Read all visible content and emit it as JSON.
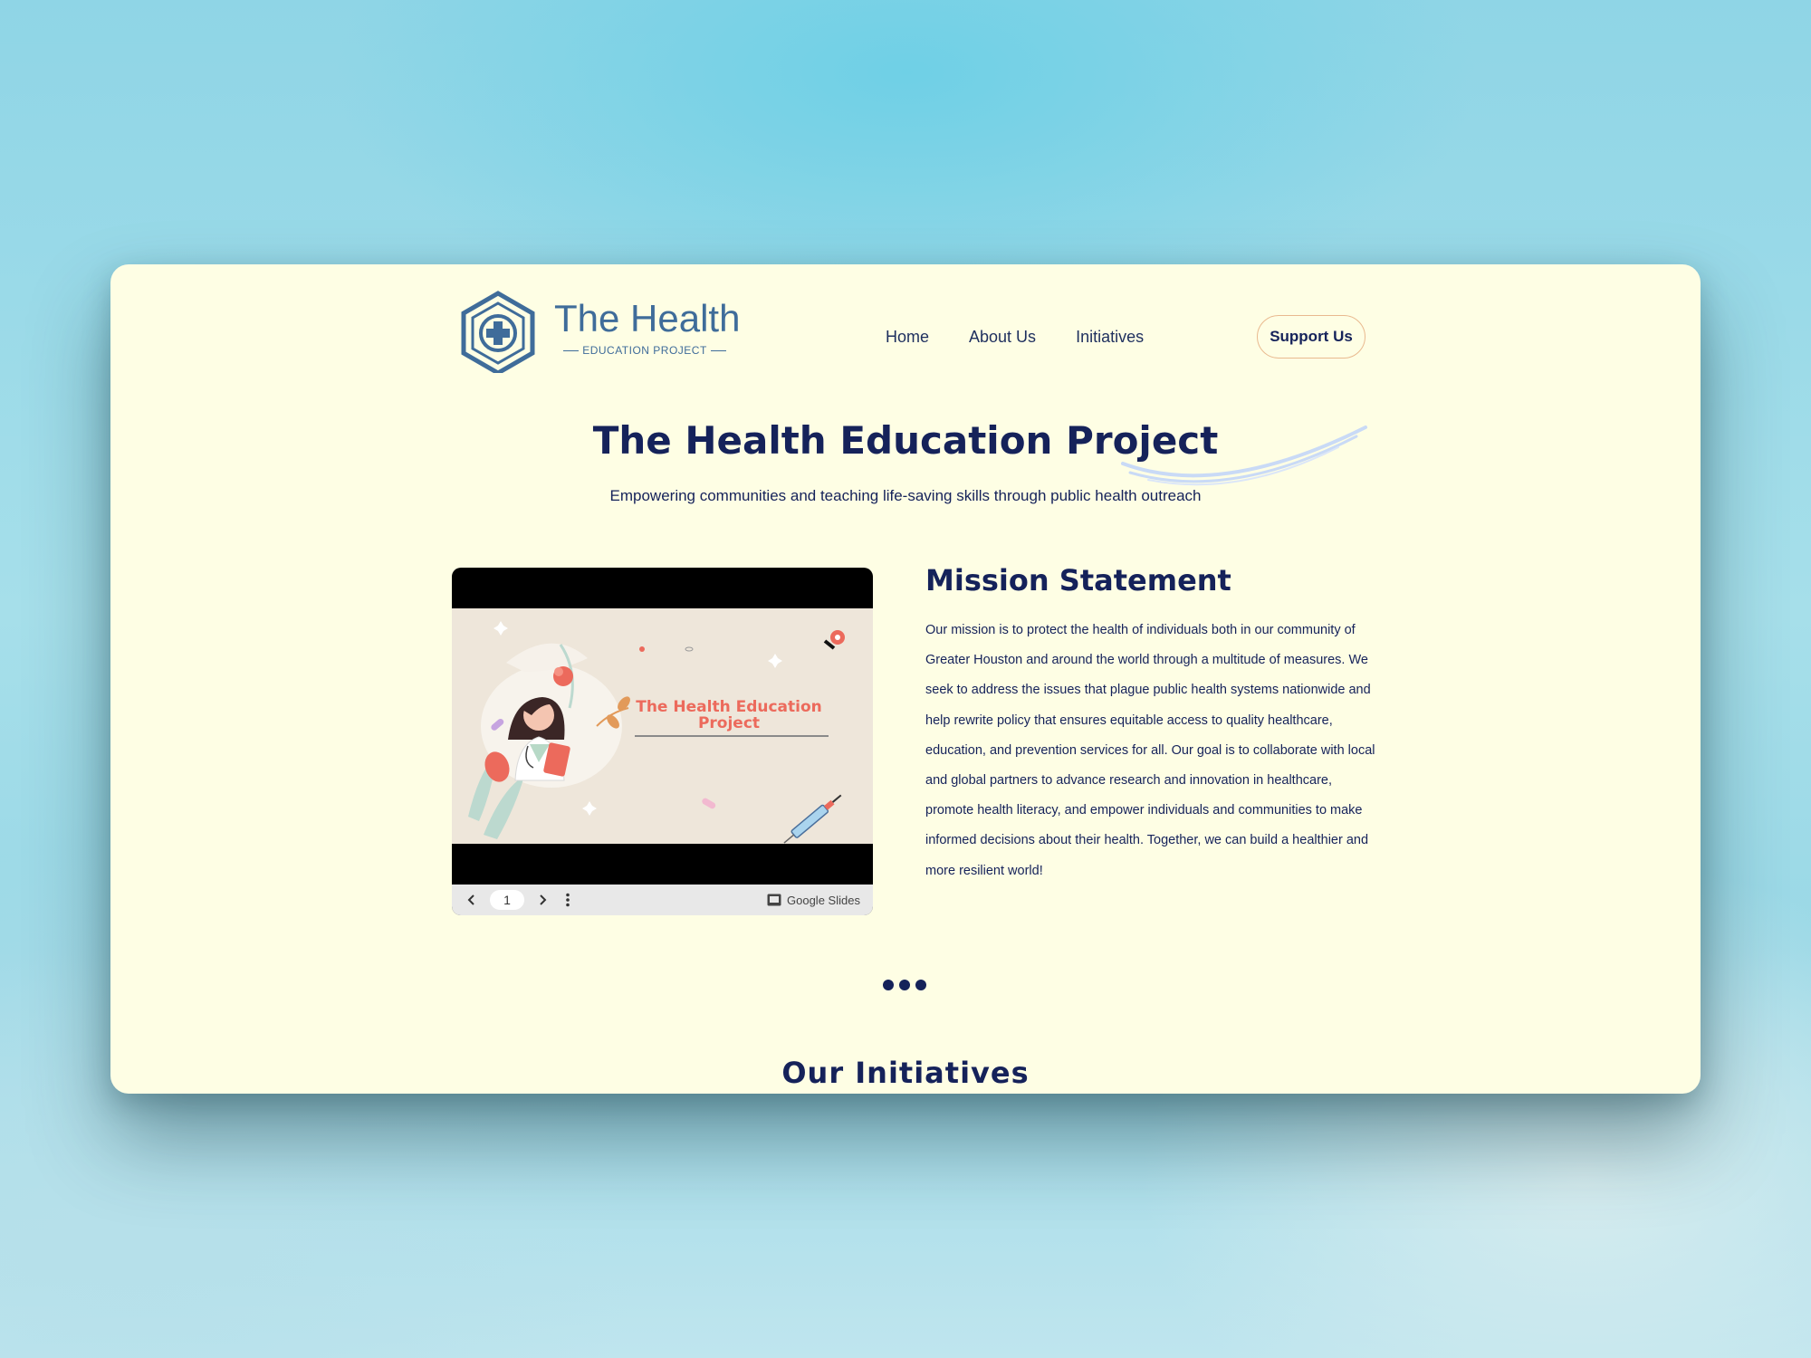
{
  "logo": {
    "title": "The Health",
    "subtitle": "EDUCATION PROJECT"
  },
  "nav": {
    "items": [
      "Home",
      "About Us",
      "Initiatives"
    ]
  },
  "support_label": "Support Us",
  "hero": {
    "title": "The Health Education Project",
    "subtitle": "Empowering communities and teaching life-saving skills through public health outreach"
  },
  "slides": {
    "slide_title": "The Health Education Project",
    "page": "1",
    "provider": "Google Slides"
  },
  "mission": {
    "title": "Mission Statement",
    "text": "Our mission is to protect the health of individuals both in our community of Greater Houston and around the world through a multitude of measures. We seek to address the issues that plague public health systems nationwide and help rewrite policy that ensures equitable access to quality healthcare, education, and prevention services for all. Our goal is to collaborate with local and global partners to advance research and innovation in healthcare, promote health literacy, and empower individuals and communities to make informed decisions about their health. Together, we can build a healthier and more resilient world!"
  },
  "initiatives": {
    "title": "Our Initiatives"
  },
  "colors": {
    "navy": "#15225a",
    "page_bg": "#fefee4",
    "logo_blue": "#3f6c9a",
    "accent_coral": "#ec6a5c",
    "button_border": "#e9b98f"
  }
}
